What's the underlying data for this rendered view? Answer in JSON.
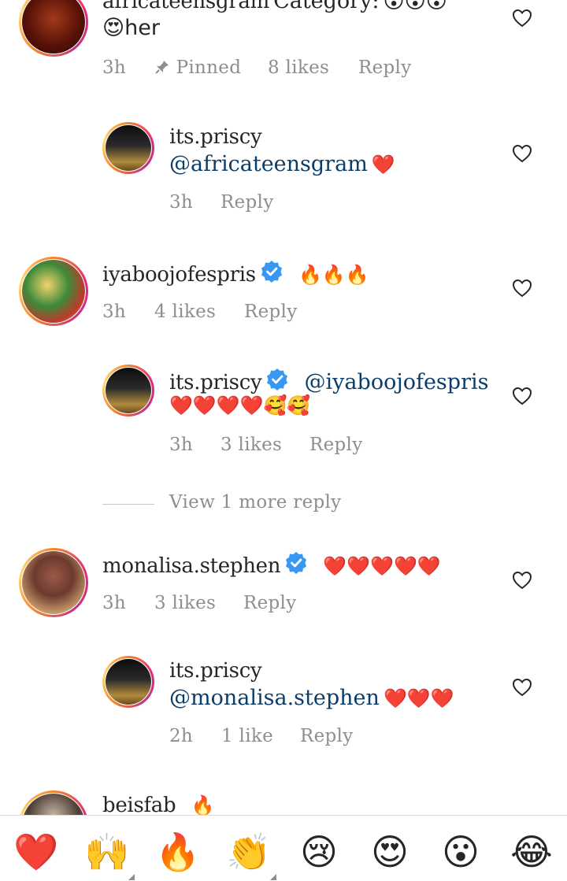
{
  "comments": [
    {
      "username": "africateensgram",
      "text_suffix": "Category:",
      "emojis_line1": "😵😵😵",
      "line2": "😍her",
      "time": "3h",
      "pinned": "Pinned",
      "likes": "8 likes",
      "reply": "Reply"
    },
    {
      "username": "its.priscy",
      "mention": "@africateensgram",
      "emojis": "❤️",
      "time": "3h",
      "reply": "Reply"
    },
    {
      "username": "iyaboojofespris",
      "emojis": "🔥🔥🔥",
      "time": "3h",
      "likes": "4 likes",
      "reply": "Reply"
    },
    {
      "username": "its.priscy",
      "mention": "@iyaboojofespris",
      "emojis": "❤️❤️❤️❤️🥰🥰",
      "time": "3h",
      "likes": "3 likes",
      "reply": "Reply"
    },
    {
      "view_more": "View 1 more reply"
    },
    {
      "username": "monalisa.stephen",
      "emojis": "❤️❤️❤️❤️❤️",
      "time": "3h",
      "likes": "3 likes",
      "reply": "Reply"
    },
    {
      "username": "its.priscy",
      "mention": "@monalisa.stephen",
      "emojis": "❤️❤️❤️",
      "time": "2h",
      "likes": "1 like",
      "reply": "Reply"
    },
    {
      "username": "beisfab",
      "emojis": "🔥"
    }
  ],
  "emoji_bar": [
    "❤️",
    "🙌",
    "🔥",
    "👏",
    "😢",
    "😍",
    "😮",
    "😂"
  ],
  "colors": {
    "username": "#262626",
    "meta": "#8e8e8e",
    "mention": "#0a3d6b",
    "verified": "#3897f0"
  },
  "icons": {
    "like": "heart-outline-icon",
    "verified": "verified-badge-icon",
    "pin": "pin-icon"
  }
}
